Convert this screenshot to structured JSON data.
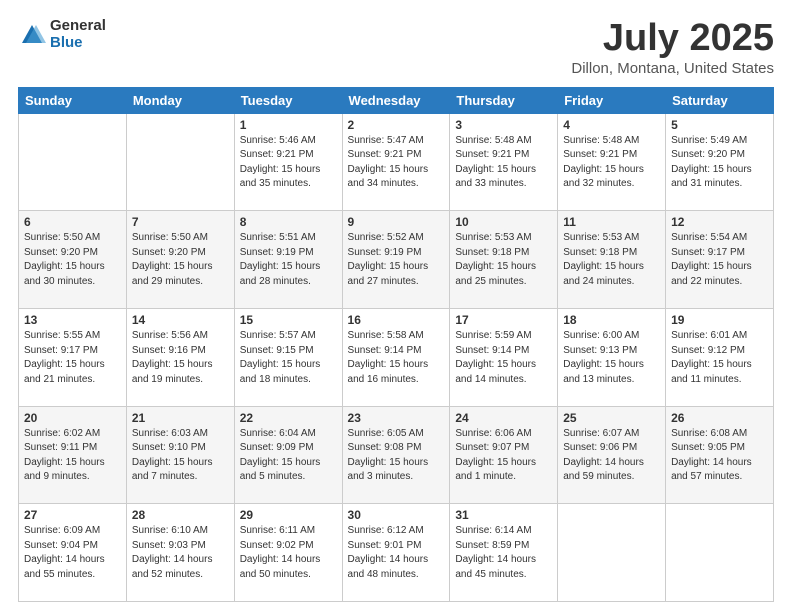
{
  "header": {
    "logo_general": "General",
    "logo_blue": "Blue",
    "month_title": "July 2025",
    "location": "Dillon, Montana, United States"
  },
  "days_of_week": [
    "Sunday",
    "Monday",
    "Tuesday",
    "Wednesday",
    "Thursday",
    "Friday",
    "Saturday"
  ],
  "weeks": [
    [
      {
        "day": "",
        "info": ""
      },
      {
        "day": "",
        "info": ""
      },
      {
        "day": "1",
        "info": "Sunrise: 5:46 AM\nSunset: 9:21 PM\nDaylight: 15 hours\nand 35 minutes."
      },
      {
        "day": "2",
        "info": "Sunrise: 5:47 AM\nSunset: 9:21 PM\nDaylight: 15 hours\nand 34 minutes."
      },
      {
        "day": "3",
        "info": "Sunrise: 5:48 AM\nSunset: 9:21 PM\nDaylight: 15 hours\nand 33 minutes."
      },
      {
        "day": "4",
        "info": "Sunrise: 5:48 AM\nSunset: 9:21 PM\nDaylight: 15 hours\nand 32 minutes."
      },
      {
        "day": "5",
        "info": "Sunrise: 5:49 AM\nSunset: 9:20 PM\nDaylight: 15 hours\nand 31 minutes."
      }
    ],
    [
      {
        "day": "6",
        "info": "Sunrise: 5:50 AM\nSunset: 9:20 PM\nDaylight: 15 hours\nand 30 minutes."
      },
      {
        "day": "7",
        "info": "Sunrise: 5:50 AM\nSunset: 9:20 PM\nDaylight: 15 hours\nand 29 minutes."
      },
      {
        "day": "8",
        "info": "Sunrise: 5:51 AM\nSunset: 9:19 PM\nDaylight: 15 hours\nand 28 minutes."
      },
      {
        "day": "9",
        "info": "Sunrise: 5:52 AM\nSunset: 9:19 PM\nDaylight: 15 hours\nand 27 minutes."
      },
      {
        "day": "10",
        "info": "Sunrise: 5:53 AM\nSunset: 9:18 PM\nDaylight: 15 hours\nand 25 minutes."
      },
      {
        "day": "11",
        "info": "Sunrise: 5:53 AM\nSunset: 9:18 PM\nDaylight: 15 hours\nand 24 minutes."
      },
      {
        "day": "12",
        "info": "Sunrise: 5:54 AM\nSunset: 9:17 PM\nDaylight: 15 hours\nand 22 minutes."
      }
    ],
    [
      {
        "day": "13",
        "info": "Sunrise: 5:55 AM\nSunset: 9:17 PM\nDaylight: 15 hours\nand 21 minutes."
      },
      {
        "day": "14",
        "info": "Sunrise: 5:56 AM\nSunset: 9:16 PM\nDaylight: 15 hours\nand 19 minutes."
      },
      {
        "day": "15",
        "info": "Sunrise: 5:57 AM\nSunset: 9:15 PM\nDaylight: 15 hours\nand 18 minutes."
      },
      {
        "day": "16",
        "info": "Sunrise: 5:58 AM\nSunset: 9:14 PM\nDaylight: 15 hours\nand 16 minutes."
      },
      {
        "day": "17",
        "info": "Sunrise: 5:59 AM\nSunset: 9:14 PM\nDaylight: 15 hours\nand 14 minutes."
      },
      {
        "day": "18",
        "info": "Sunrise: 6:00 AM\nSunset: 9:13 PM\nDaylight: 15 hours\nand 13 minutes."
      },
      {
        "day": "19",
        "info": "Sunrise: 6:01 AM\nSunset: 9:12 PM\nDaylight: 15 hours\nand 11 minutes."
      }
    ],
    [
      {
        "day": "20",
        "info": "Sunrise: 6:02 AM\nSunset: 9:11 PM\nDaylight: 15 hours\nand 9 minutes."
      },
      {
        "day": "21",
        "info": "Sunrise: 6:03 AM\nSunset: 9:10 PM\nDaylight: 15 hours\nand 7 minutes."
      },
      {
        "day": "22",
        "info": "Sunrise: 6:04 AM\nSunset: 9:09 PM\nDaylight: 15 hours\nand 5 minutes."
      },
      {
        "day": "23",
        "info": "Sunrise: 6:05 AM\nSunset: 9:08 PM\nDaylight: 15 hours\nand 3 minutes."
      },
      {
        "day": "24",
        "info": "Sunrise: 6:06 AM\nSunset: 9:07 PM\nDaylight: 15 hours\nand 1 minute."
      },
      {
        "day": "25",
        "info": "Sunrise: 6:07 AM\nSunset: 9:06 PM\nDaylight: 14 hours\nand 59 minutes."
      },
      {
        "day": "26",
        "info": "Sunrise: 6:08 AM\nSunset: 9:05 PM\nDaylight: 14 hours\nand 57 minutes."
      }
    ],
    [
      {
        "day": "27",
        "info": "Sunrise: 6:09 AM\nSunset: 9:04 PM\nDaylight: 14 hours\nand 55 minutes."
      },
      {
        "day": "28",
        "info": "Sunrise: 6:10 AM\nSunset: 9:03 PM\nDaylight: 14 hours\nand 52 minutes."
      },
      {
        "day": "29",
        "info": "Sunrise: 6:11 AM\nSunset: 9:02 PM\nDaylight: 14 hours\nand 50 minutes."
      },
      {
        "day": "30",
        "info": "Sunrise: 6:12 AM\nSunset: 9:01 PM\nDaylight: 14 hours\nand 48 minutes."
      },
      {
        "day": "31",
        "info": "Sunrise: 6:14 AM\nSunset: 8:59 PM\nDaylight: 14 hours\nand 45 minutes."
      },
      {
        "day": "",
        "info": ""
      },
      {
        "day": "",
        "info": ""
      }
    ]
  ]
}
